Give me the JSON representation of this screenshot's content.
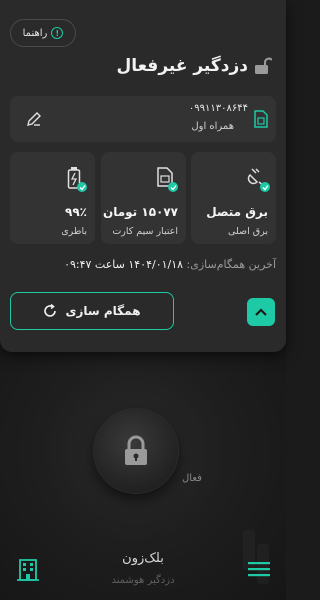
{
  "colors": {
    "accent": "#1ec9a5",
    "panel": "#2a2a2a",
    "card": "#333333",
    "background": "#1b1b1b"
  },
  "header": {
    "help_label": "راهنما",
    "status_title": "دزدگیر غیرفعال",
    "status_icon": "unlock-icon"
  },
  "sim": {
    "number": "۰۹۹۱۱۳۰۸۶۴۴",
    "name": "همراه اول",
    "icon": "sim-card-icon",
    "edit_icon": "edit-icon"
  },
  "stats": [
    {
      "value": "برق متصل",
      "label": "برق اصلی",
      "icon": "power-plug-icon"
    },
    {
      "value": "۱۵۰۷۷ تومان",
      "label": "اعتبار سیم کارت",
      "icon": "sim-credit-icon"
    },
    {
      "value": "۹۹٪",
      "label": "باطری",
      "icon": "battery-icon"
    }
  ],
  "sync": {
    "last_sync_key": "آخرین همگام‌سازی:",
    "last_sync_value": "۱۴۰۴/۰۱/۱۸ ساعت ۰۹:۴۷",
    "button_label": "همگام سازی"
  },
  "main": {
    "lock_state_label": "فعال",
    "device_name": "بلک‌زون",
    "device_subtitle": "دزدگیر هوشمند"
  }
}
